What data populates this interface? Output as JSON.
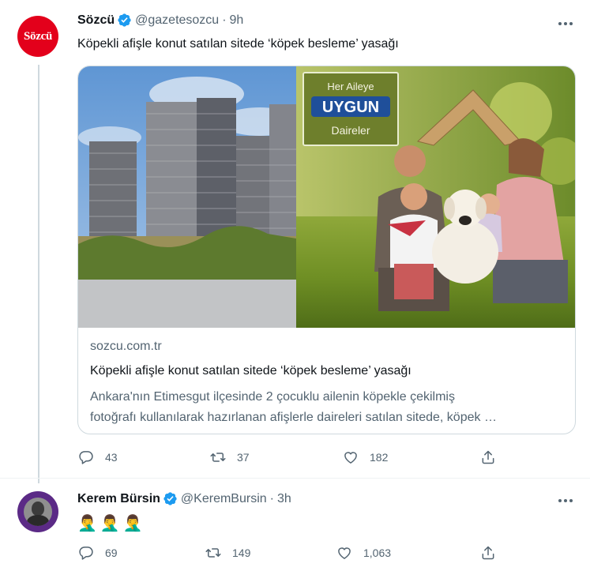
{
  "tweets": [
    {
      "avatar_text": "Sözcü",
      "name": "Sözcü",
      "handle": "@gazetesozcu",
      "separator": "·",
      "time": "9h",
      "text": "Köpekli afişle konut satılan sitede ‘köpek besleme’ yasağı",
      "card": {
        "domain": "sozcu.com.tr",
        "title": "Köpekli afişle konut satılan sitede ‘köpek besleme’ yasağı",
        "desc_line1": "Ankara'nın Etimesgut ilçesinde 2 çocuklu ailenin köpekle çekilmiş",
        "desc_line2": "fotoğrafı kullanılarak hazırlanan afişlerle daireleri satılan sitede, köpek …",
        "billboard_line1": "Her Aileye",
        "billboard_line2": "UYGUN",
        "billboard_line3": "Daireler"
      },
      "replies": "43",
      "retweets": "37",
      "likes": "182"
    },
    {
      "name": "Kerem Bürsin",
      "handle": "@KeremBursin",
      "separator": "·",
      "time": "3h",
      "text": "🤦‍♂️🤦‍♂️🤦‍♂️",
      "replies": "69",
      "retweets": "149",
      "likes": "1,063"
    }
  ],
  "icons": {
    "verified": "verified-badge-icon",
    "more": "more-icon",
    "reply": "reply-icon",
    "retweet": "retweet-icon",
    "like": "like-icon",
    "share": "share-icon"
  },
  "colors": {
    "text": "#0f1419",
    "secondary": "#536471",
    "verified": "#1d9bf0",
    "sozcu_red": "#e3001b",
    "border": "#cfd9de"
  }
}
